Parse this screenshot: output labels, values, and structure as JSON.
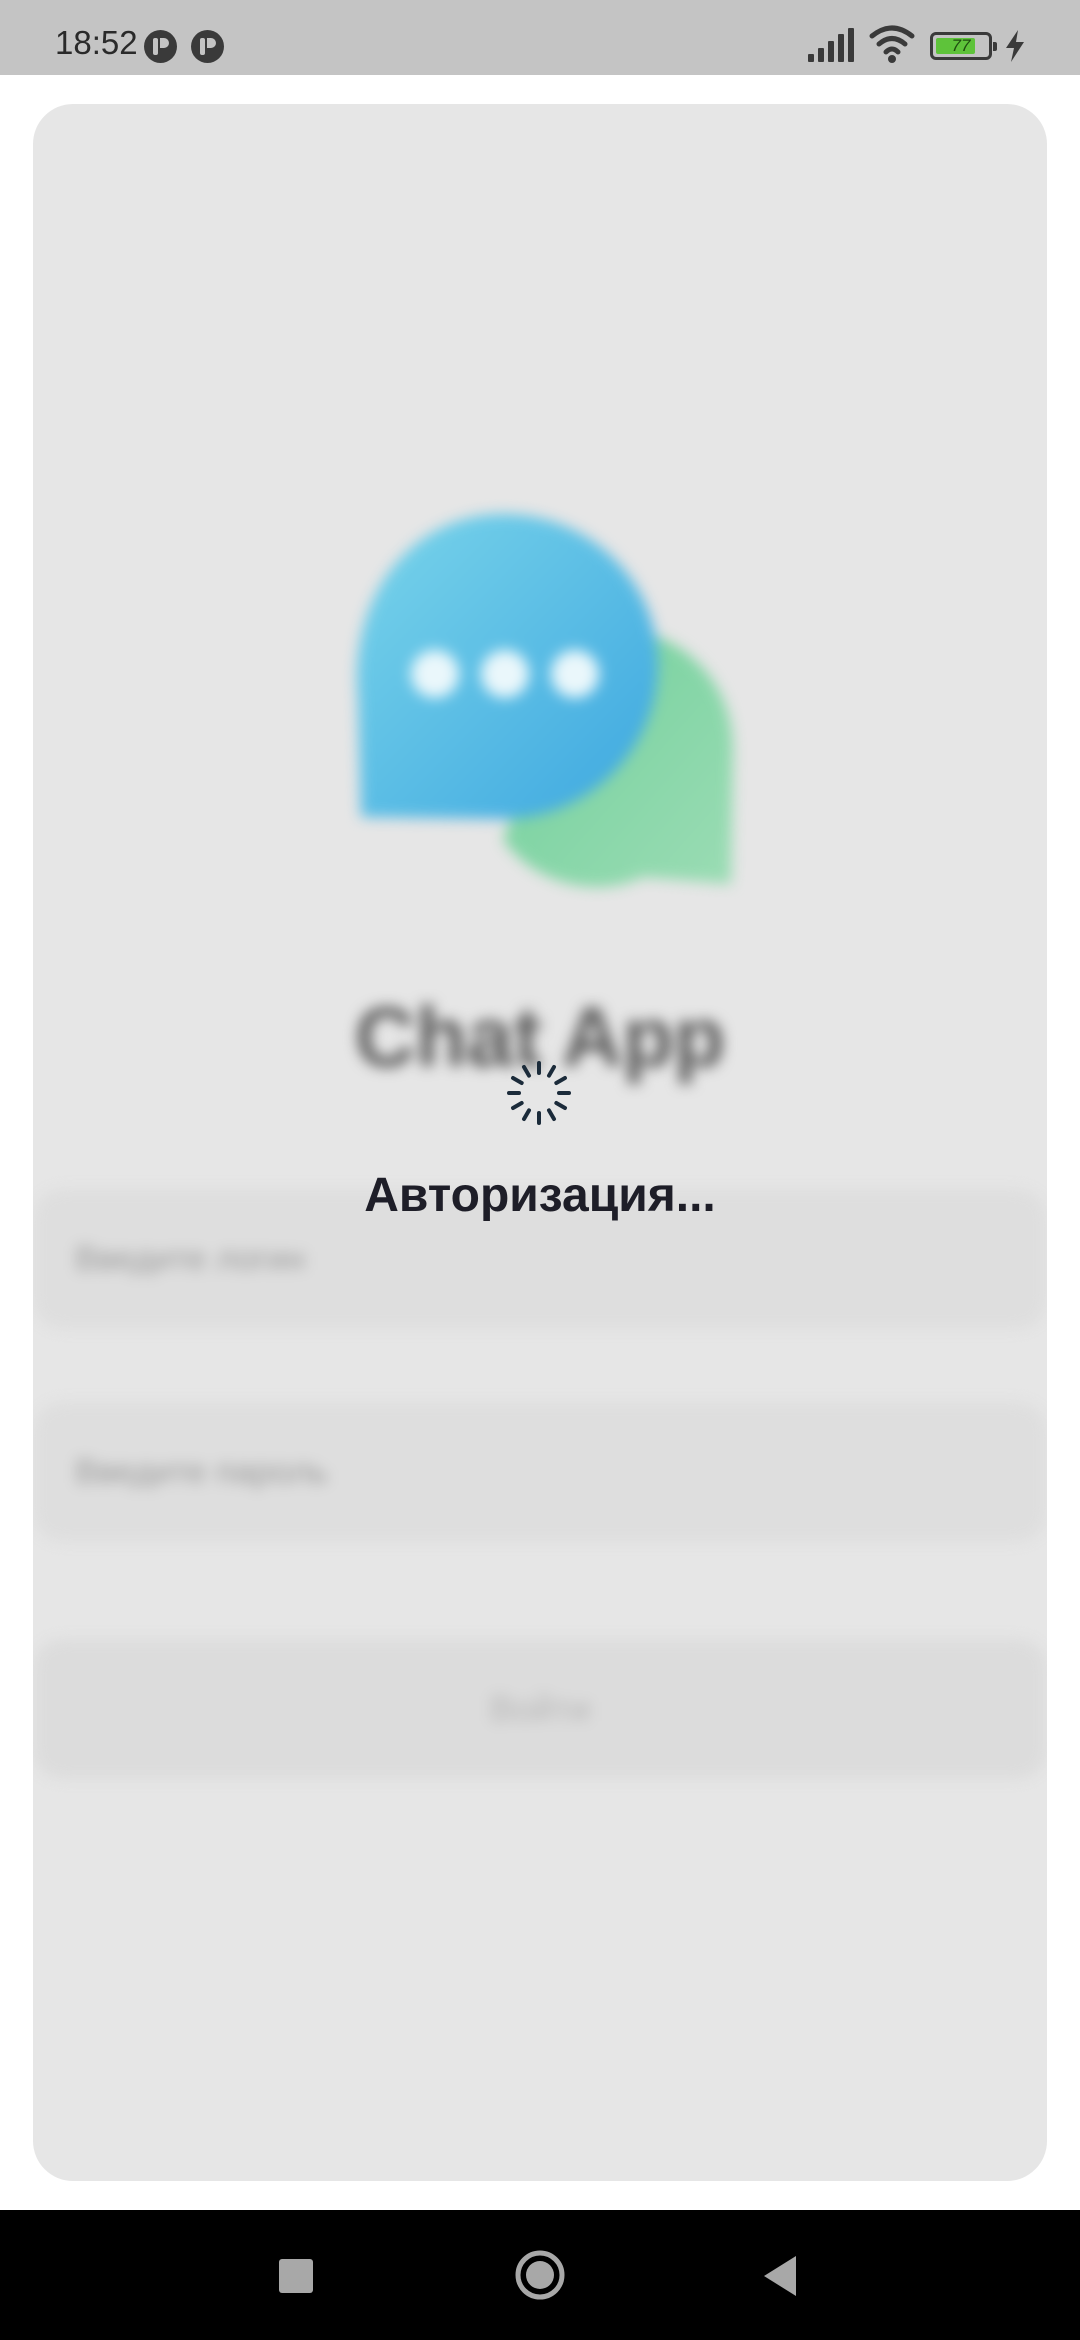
{
  "status_bar": {
    "time": "18:52",
    "battery_level": "77",
    "battery_fraction": 0.77,
    "icons": [
      "notification-app-icon",
      "notification-app-icon",
      "signal-icon",
      "wifi-icon",
      "battery-icon",
      "charging-bolt-icon"
    ]
  },
  "login": {
    "app_title": "Chat App",
    "login_placeholder": "Введите логин",
    "password_placeholder": "Введите пароль",
    "submit_label": "Войти",
    "logo_icon": "chat-bubbles-logo-icon",
    "colors": {
      "bubble_blue": "#4fb7e3",
      "bubble_green": "#7fd3a3",
      "card_background": "#e6e6e6"
    }
  },
  "overlay": {
    "status_text": "Авторизация...",
    "spinner_icon": "loading-spinner-icon",
    "text_color": "#1e1e28"
  },
  "nav_bar": {
    "buttons": [
      "recents-icon",
      "home-icon",
      "back-icon"
    ]
  }
}
